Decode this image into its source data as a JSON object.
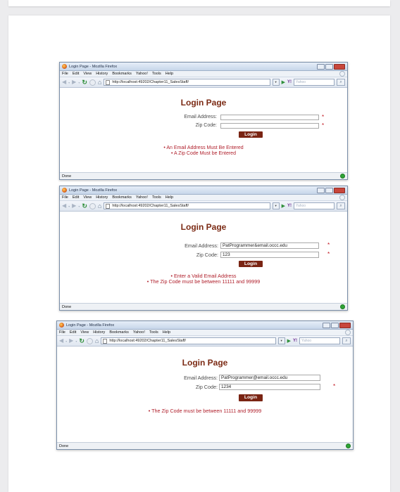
{
  "browser": {
    "window_title": "Login Page - Mozilla Firefox",
    "menu": [
      "File",
      "Edit",
      "View",
      "History",
      "Bookmarks",
      "Yahoo!",
      "Tools",
      "Help"
    ],
    "url": "http://localhost:49202/Chapter11_SalesStaff/",
    "yahoo_button": "Y!",
    "search_placeholder": "Yahoo",
    "status_text": "Done"
  },
  "page": {
    "title": "Login Page",
    "email_label": "Email Address:",
    "zip_label": "Zip Code:",
    "required_marker": "*",
    "login_button": "Login"
  },
  "screens": [
    {
      "email_value": "",
      "zip_value": "",
      "errors": [
        "An Email Address Must Be Entered",
        "A Zip Code Must be Entered"
      ]
    },
    {
      "email_value": "PatProgrammer&email.occc.edu",
      "zip_value": "123",
      "errors": [
        "Enter a Valid Email Address",
        "The Zip Code must be between 11111 and 99999"
      ]
    },
    {
      "email_value": "PatProgrammer@email.occc.edu",
      "zip_value": "1234",
      "errors": [
        "The Zip Code must be between 11111 and 99999"
      ]
    }
  ],
  "colors": {
    "title": "#7b2a14",
    "button": "#7a2413",
    "error": "#b0202c",
    "required": "#c0141e"
  }
}
